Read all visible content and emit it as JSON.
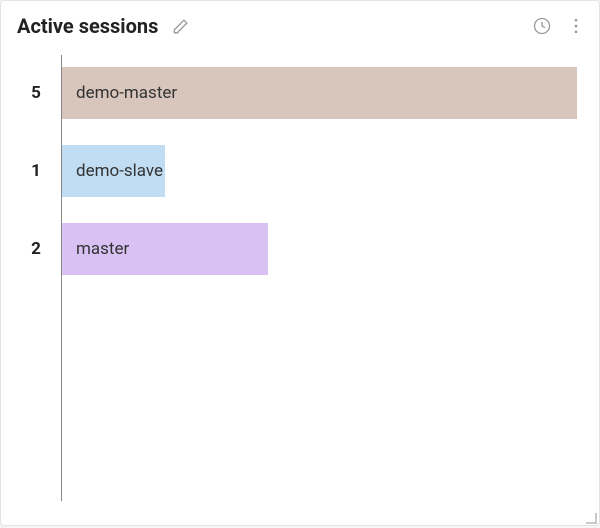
{
  "panel": {
    "title": "Active sessions"
  },
  "icons": {
    "edit": "pencil-icon",
    "time": "clock-icon",
    "menu": "more-vert-icon",
    "resize": "resize-handle-icon"
  },
  "chart_data": {
    "type": "bar",
    "orientation": "horizontal",
    "title": "Active sessions",
    "xlabel": "",
    "ylabel": "",
    "xlim": [
      0,
      5
    ],
    "categories": [
      "demo-master",
      "demo-slave",
      "master"
    ],
    "values": [
      5,
      1,
      2
    ],
    "series": [
      {
        "name": "demo-master",
        "value": 5,
        "color": "#d8c6bd"
      },
      {
        "name": "demo-slave",
        "value": 1,
        "color": "#c1ddf3"
      },
      {
        "name": "master",
        "value": 2,
        "color": "#d9c2f3"
      }
    ]
  }
}
